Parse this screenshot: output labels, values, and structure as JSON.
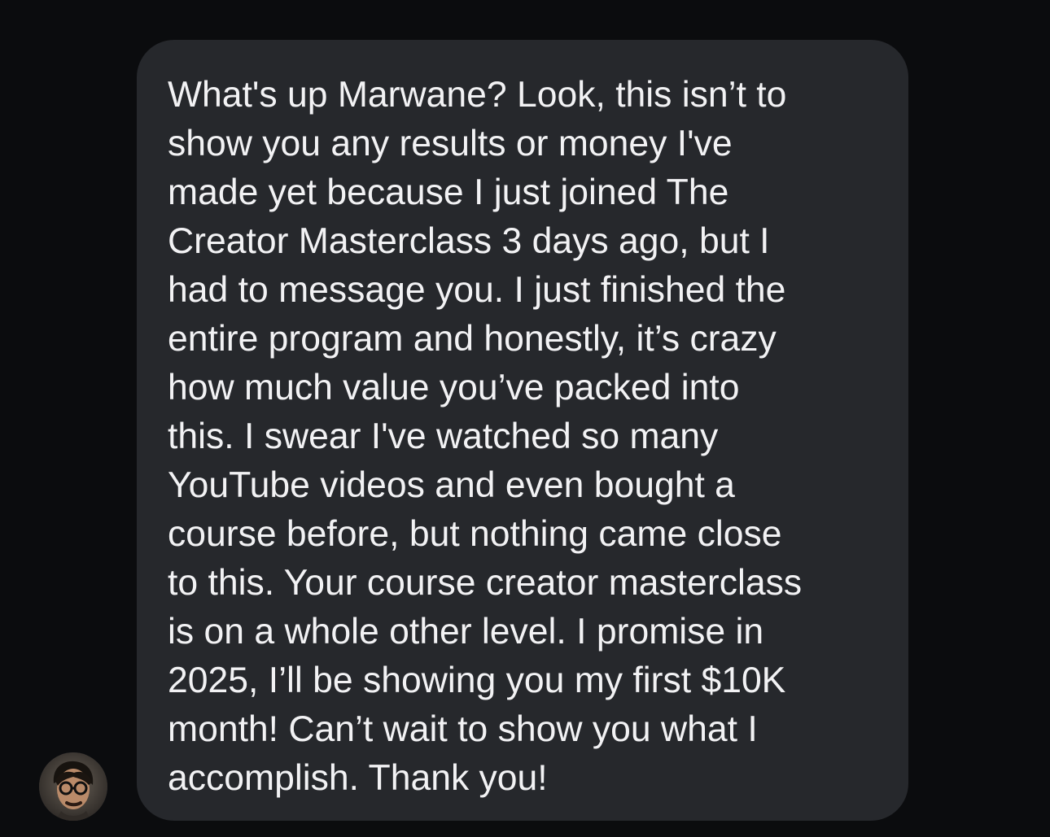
{
  "message": {
    "sender_avatar_icon": "user-avatar-photo",
    "lines": [
      "What's up Marwane? Look, this isn’t to",
      "show you any results or money I've",
      "made yet because I just joined The",
      "Creator Masterclass 3 days ago, but I",
      "had to message you. I just finished the",
      "entire program and honestly, it’s crazy",
      "how much value you’ve packed into",
      "this. I swear I've watched so many",
      "YouTube videos and even bought a",
      "course before, but nothing came close",
      "to this. Your course creator masterclass",
      "is on a whole other level. I promise in",
      "2025, I’ll be showing you my first $10K",
      "month! Can’t wait to show you what I",
      "accomplish. Thank you!"
    ]
  },
  "colors": {
    "background": "#0b0c0e",
    "bubble": "#26282c",
    "text": "#f2f2f4"
  }
}
